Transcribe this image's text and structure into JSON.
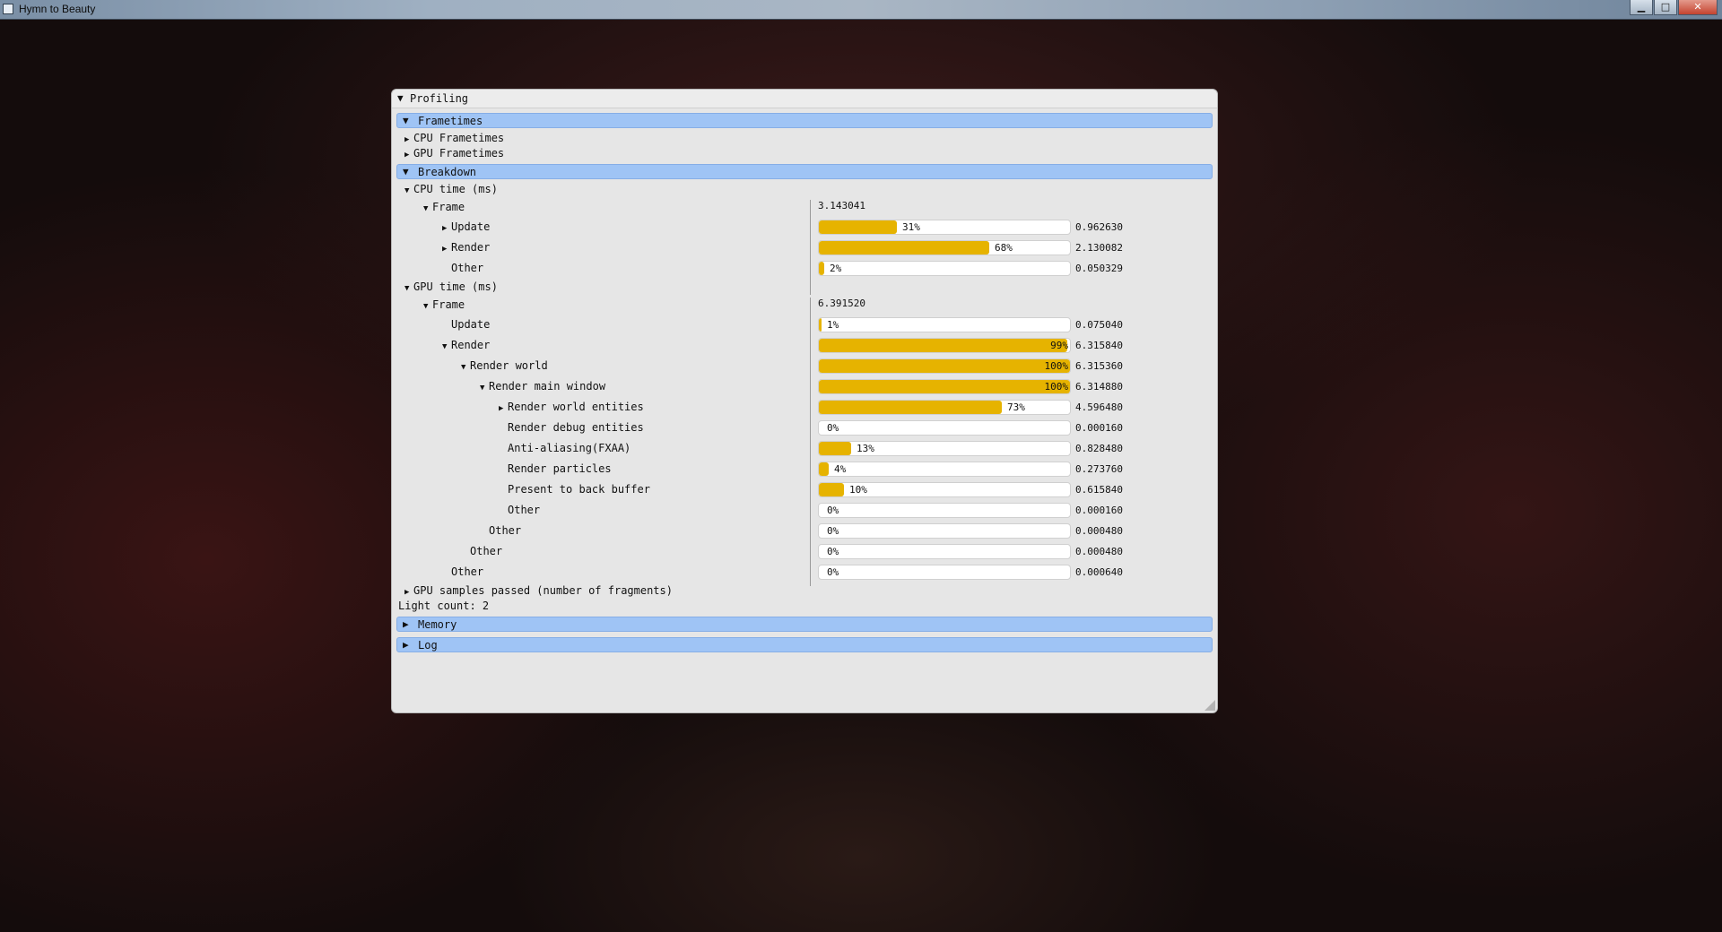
{
  "window": {
    "title": "Hymn to Beauty",
    "buttons": {
      "minimize": "▁",
      "maximize": "□",
      "close": "✕"
    }
  },
  "panel": {
    "title": "Profiling",
    "frametimes": {
      "label": "Frametimes",
      "items": [
        "CPU Frametimes",
        "GPU Frametimes"
      ]
    },
    "breakdown": {
      "label": "Breakdown",
      "cpu": {
        "label": "CPU time (ms)",
        "frame_label": "Frame",
        "frame_value": "3.143041",
        "rows": [
          {
            "label": "Update",
            "pct": 31,
            "pct_text": "31%",
            "value": "0.962630"
          },
          {
            "label": "Render",
            "pct": 68,
            "pct_text": "68%",
            "value": "2.130082"
          },
          {
            "label": "Other",
            "pct": 2,
            "pct_text": "2%",
            "value": "0.050329"
          }
        ]
      },
      "gpu": {
        "label": "GPU time (ms)",
        "frame_label": "Frame",
        "frame_value": "6.391520",
        "rows": [
          {
            "label": "Update",
            "pct": 1,
            "pct_text": "1%",
            "value": "0.075040"
          },
          {
            "label": "Render",
            "pct": 99,
            "pct_text": "99%",
            "value": "6.315840"
          },
          {
            "label": "Render world",
            "pct": 100,
            "pct_text": "100%",
            "value": "6.315360"
          },
          {
            "label": "Render main window",
            "pct": 100,
            "pct_text": "100%",
            "value": "6.314880"
          },
          {
            "label": "Render world entities",
            "pct": 73,
            "pct_text": "73%",
            "value": "4.596480"
          },
          {
            "label": "Render debug entities",
            "pct": 0,
            "pct_text": "0%",
            "value": "0.000160"
          },
          {
            "label": "Anti-aliasing(FXAA)",
            "pct": 13,
            "pct_text": "13%",
            "value": "0.828480"
          },
          {
            "label": "Render particles",
            "pct": 4,
            "pct_text": "4%",
            "value": "0.273760"
          },
          {
            "label": "Present to back buffer",
            "pct": 10,
            "pct_text": "10%",
            "value": "0.615840"
          },
          {
            "label": "Other",
            "pct": 0,
            "pct_text": "0%",
            "value": "0.000160"
          },
          {
            "label": "Other",
            "pct": 0,
            "pct_text": "0%",
            "value": "0.000480"
          },
          {
            "label": "Other",
            "pct": 0,
            "pct_text": "0%",
            "value": "0.000480"
          },
          {
            "label": "Other",
            "pct": 0,
            "pct_text": "0%",
            "value": "0.000640"
          }
        ]
      },
      "samples_label": "GPU samples passed (number of fragments)",
      "light_count": "Light count: 2"
    },
    "memory": {
      "label": "Memory"
    },
    "log": {
      "label": "Log"
    }
  },
  "colors": {
    "header_bg": "#9fc4f5",
    "bar_fill": "#e6b300",
    "panel_bg": "#e6e6e6"
  }
}
